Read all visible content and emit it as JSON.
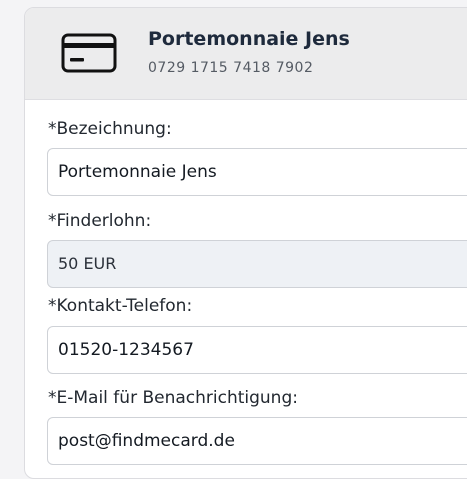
{
  "card": {
    "title": "Portemonnaie Jens",
    "number": "0729 1715 7418 7902",
    "icon": "credit-card-icon"
  },
  "fields": [
    {
      "label": "*Bezeichnung:",
      "value": "Portemonnaie Jens",
      "readonly": false
    },
    {
      "label": "*Finderlohn:",
      "value": "50 EUR",
      "readonly": true
    },
    {
      "label": "*Kontakt-Telefon:",
      "value": "01520-1234567",
      "readonly": false
    },
    {
      "label": "*E-Mail für Benachrichtigung:",
      "value": "post@findmecard.de",
      "readonly": false
    }
  ],
  "colors": {
    "header_bg": "#ececed",
    "readonly_bg": "#eef1f5",
    "title": "#1e2a3c"
  }
}
